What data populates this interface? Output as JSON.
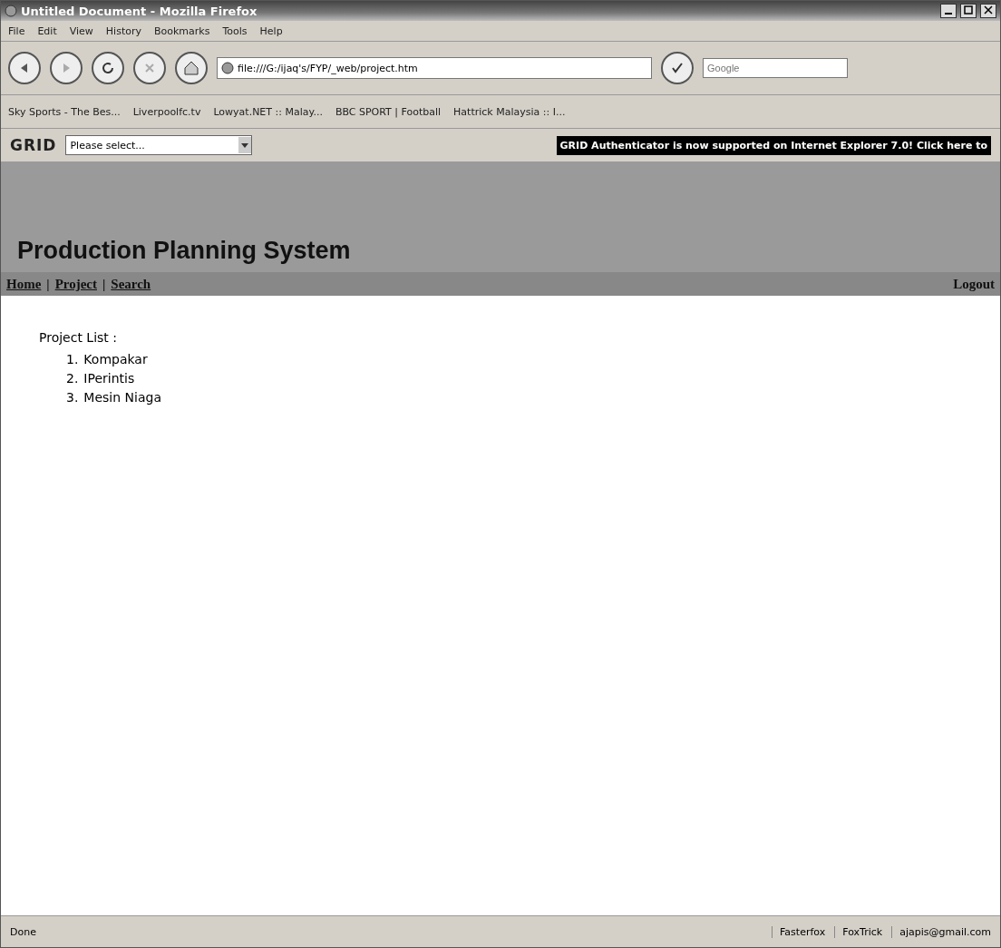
{
  "window": {
    "title": "Untitled Document - Mozilla Firefox"
  },
  "menu": [
    "File",
    "Edit",
    "View",
    "History",
    "Bookmarks",
    "Tools",
    "Help"
  ],
  "address": {
    "value": "file:///G:/ijaq's/FYP/_web/project.htm"
  },
  "search": {
    "placeholder": "Google"
  },
  "bookmarks": [
    {
      "label": "Sky Sports - The Bes..."
    },
    {
      "label": "Liverpoolfc.tv"
    },
    {
      "label": "Lowyat.NET :: Malay..."
    },
    {
      "label": "BBC SPORT | Football"
    },
    {
      "label": "Hattrick Malaysia :: I..."
    }
  ],
  "grid_toolbar": {
    "logo": "GRID",
    "select": "Please select...",
    "banner": "GRID Authenticator is now supported on Internet Explorer 7.0! Click here to"
  },
  "page": {
    "title": "Production Planning System",
    "nav": [
      {
        "kind": "link",
        "label": "Home"
      },
      {
        "kind": "separator",
        "label": "|"
      },
      {
        "kind": "link",
        "label": "Project"
      },
      {
        "kind": "separator",
        "label": "|"
      },
      {
        "kind": "link",
        "label": "Search"
      }
    ],
    "logout": "Logout",
    "list_heading": "Project List :",
    "projects": [
      {
        "number": "1.",
        "name": "Kompakar"
      },
      {
        "number": "2.",
        "name": "IPerintis"
      },
      {
        "number": "3.",
        "name": "Mesin Niaga"
      }
    ]
  },
  "status_bar": {
    "text": "Done",
    "items": [
      "Fasterfox",
      "FoxTrick",
      "ajapis@gmail.com"
    ]
  }
}
